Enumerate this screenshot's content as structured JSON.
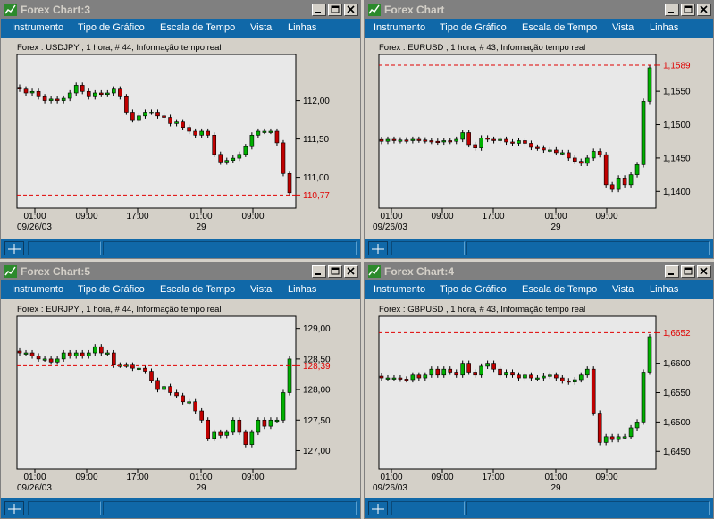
{
  "menu": [
    "Instrumento",
    "Tipo de Gráfico",
    "Escala de Tempo",
    "Vista",
    "Linhas"
  ],
  "colors": {
    "up": "#00b000",
    "down": "#c00000",
    "level": "#e00000",
    "menubar": "#1068a8"
  },
  "windows": [
    {
      "title": "Forex Chart:3",
      "info": "Forex : USDJPY , 1 hora, # 44, Informação tempo real",
      "level_label": "110,77",
      "ticks": [
        {
          "value": 112.0,
          "label": "112,00"
        },
        {
          "value": 111.5,
          "label": "111,50"
        },
        {
          "value": 111.0,
          "label": "111,00"
        }
      ],
      "x_labels": [
        "01:00",
        "09:00",
        "17:00",
        "01:00",
        "09:00"
      ],
      "date_labels": [
        "09/26/03",
        "29"
      ],
      "chart_data": {
        "type": "candlestick",
        "ylim": [
          110.6,
          112.6
        ],
        "level": 110.77,
        "close": [
          112.15,
          112.1,
          112.12,
          112.05,
          112.0,
          112.02,
          112.0,
          112.03,
          112.1,
          112.2,
          112.12,
          112.05,
          112.1,
          112.08,
          112.1,
          112.15,
          112.05,
          111.85,
          111.75,
          111.8,
          111.85,
          111.85,
          111.8,
          111.78,
          111.7,
          111.72,
          111.65,
          111.6,
          111.55,
          111.6,
          111.55,
          111.3,
          111.2,
          111.22,
          111.25,
          111.3,
          111.4,
          111.55,
          111.6,
          111.6,
          111.6,
          111.45,
          111.05,
          110.8
        ]
      }
    },
    {
      "title": "Forex Chart",
      "info": "Forex : EURUSD , 1 hora, # 43, Informação tempo real",
      "level_label": "1,1589",
      "ticks": [
        {
          "value": 1.155,
          "label": "1,1550"
        },
        {
          "value": 1.15,
          "label": "1,1500"
        },
        {
          "value": 1.145,
          "label": "1,1450"
        },
        {
          "value": 1.14,
          "label": "1,1400"
        }
      ],
      "x_labels": [
        "01:00",
        "09:00",
        "17:00",
        "01:00",
        "09:00"
      ],
      "date_labels": [
        "09/26/03",
        "29"
      ],
      "chart_data": {
        "type": "candlestick",
        "ylim": [
          1.1375,
          1.1605
        ],
        "level": 1.1589,
        "close": [
          1.1475,
          1.1478,
          1.1476,
          1.1477,
          1.1476,
          1.1478,
          1.1477,
          1.1476,
          1.1475,
          1.1474,
          1.1476,
          1.1475,
          1.1478,
          1.1488,
          1.147,
          1.1465,
          1.148,
          1.1478,
          1.1476,
          1.1478,
          1.1474,
          1.1472,
          1.1476,
          1.1472,
          1.1466,
          1.1465,
          1.1462,
          1.1462,
          1.1458,
          1.1458,
          1.145,
          1.1445,
          1.1442,
          1.145,
          1.146,
          1.1455,
          1.141,
          1.1403,
          1.142,
          1.141,
          1.1425,
          1.144,
          1.1535,
          1.1585
        ]
      }
    },
    {
      "title": "Forex Chart:5",
      "info": "Forex : EURJPY , 1 hora, # 44, Informação tempo real",
      "level_label": "128,39",
      "ticks": [
        {
          "value": 129.0,
          "label": "129,00"
        },
        {
          "value": 128.5,
          "label": "128,50"
        },
        {
          "value": 128.0,
          "label": "128,00"
        },
        {
          "value": 127.5,
          "label": "127,50"
        },
        {
          "value": 127.0,
          "label": "127,00"
        }
      ],
      "x_labels": [
        "01:00",
        "09:00",
        "17:00",
        "01:00",
        "09:00"
      ],
      "date_labels": [
        "09/26/03",
        "29"
      ],
      "chart_data": {
        "type": "candlestick",
        "ylim": [
          126.7,
          129.2
        ],
        "level": 128.39,
        "close": [
          128.6,
          128.6,
          128.55,
          128.5,
          128.5,
          128.45,
          128.5,
          128.6,
          128.55,
          128.6,
          128.55,
          128.6,
          128.7,
          128.6,
          128.6,
          128.4,
          128.4,
          128.4,
          128.35,
          128.35,
          128.3,
          128.15,
          128.0,
          128.05,
          127.95,
          127.9,
          127.8,
          127.8,
          127.65,
          127.5,
          127.2,
          127.3,
          127.25,
          127.3,
          127.5,
          127.3,
          127.1,
          127.3,
          127.5,
          127.4,
          127.5,
          127.5,
          127.95,
          128.5
        ]
      }
    },
    {
      "title": "Forex Chart:4",
      "info": "Forex : GBPUSD , 1 hora, # 43, Informação tempo real",
      "level_label": "1,6652",
      "ticks": [
        {
          "value": 1.66,
          "label": "1,6600"
        },
        {
          "value": 1.655,
          "label": "1,6550"
        },
        {
          "value": 1.65,
          "label": "1,6500"
        },
        {
          "value": 1.645,
          "label": "1,6450"
        }
      ],
      "x_labels": [
        "01:00",
        "09:00",
        "17:00",
        "01:00",
        "09:00"
      ],
      "date_labels": [
        "09/26/03",
        "29"
      ],
      "chart_data": {
        "type": "candlestick",
        "ylim": [
          1.642,
          1.668
        ],
        "level": 1.6652,
        "close": [
          1.6575,
          1.6575,
          1.6575,
          1.6573,
          1.6572,
          1.658,
          1.6575,
          1.658,
          1.659,
          1.658,
          1.659,
          1.6585,
          1.658,
          1.66,
          1.6585,
          1.658,
          1.6595,
          1.66,
          1.659,
          1.658,
          1.6585,
          1.658,
          1.6575,
          1.658,
          1.6575,
          1.6575,
          1.6578,
          1.658,
          1.6575,
          1.657,
          1.6568,
          1.6572,
          1.658,
          1.659,
          1.6515,
          1.6465,
          1.6475,
          1.647,
          1.6475,
          1.6475,
          1.649,
          1.65,
          1.6585,
          1.6645
        ]
      }
    }
  ]
}
